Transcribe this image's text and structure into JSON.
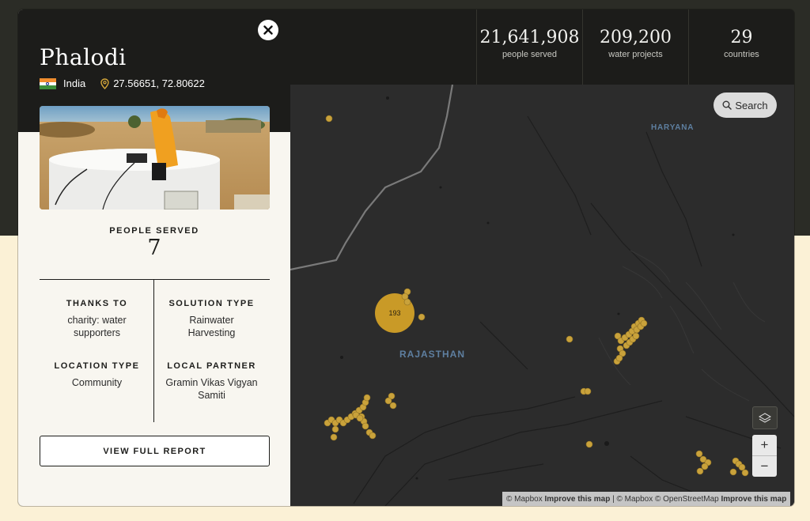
{
  "location": {
    "name": "Phalodi",
    "country": "India",
    "coordinates": "27.56651, 72.80622"
  },
  "people_served": {
    "label": "PEOPLE SERVED",
    "value": "7"
  },
  "details": [
    {
      "label": "THANKS TO",
      "value": "charity: water supporters"
    },
    {
      "label": "SOLUTION TYPE",
      "value": "Rainwater Harvesting"
    },
    {
      "label": "LOCATION TYPE",
      "value": "Community"
    },
    {
      "label": "LOCAL PARTNER",
      "value": "Gramin Vikas Vigyan Samiti"
    }
  ],
  "report_button": "VIEW FULL REPORT",
  "stats": [
    {
      "value": "21,641,908",
      "label": "people served"
    },
    {
      "value": "209,200",
      "label": "water projects"
    },
    {
      "value": "29",
      "label": "countries"
    }
  ],
  "map": {
    "search_label": "Search",
    "zoom_in": "+",
    "zoom_out": "−",
    "region_labels": [
      "HARYANA",
      "RAJASTHAN"
    ],
    "cluster_count": "193",
    "attribution": {
      "prefix": "© Mapbox",
      "improve1": "Improve this map",
      "sep": "| © Mapbox © OpenStreetMap",
      "improve2": "Improve this map"
    },
    "marker_color": "#c9a23b"
  },
  "icons": {
    "close": "close-icon",
    "location_pin": "location-pin-icon",
    "search": "search-icon",
    "layers": "layers-icon",
    "flag": "india-flag-icon"
  }
}
